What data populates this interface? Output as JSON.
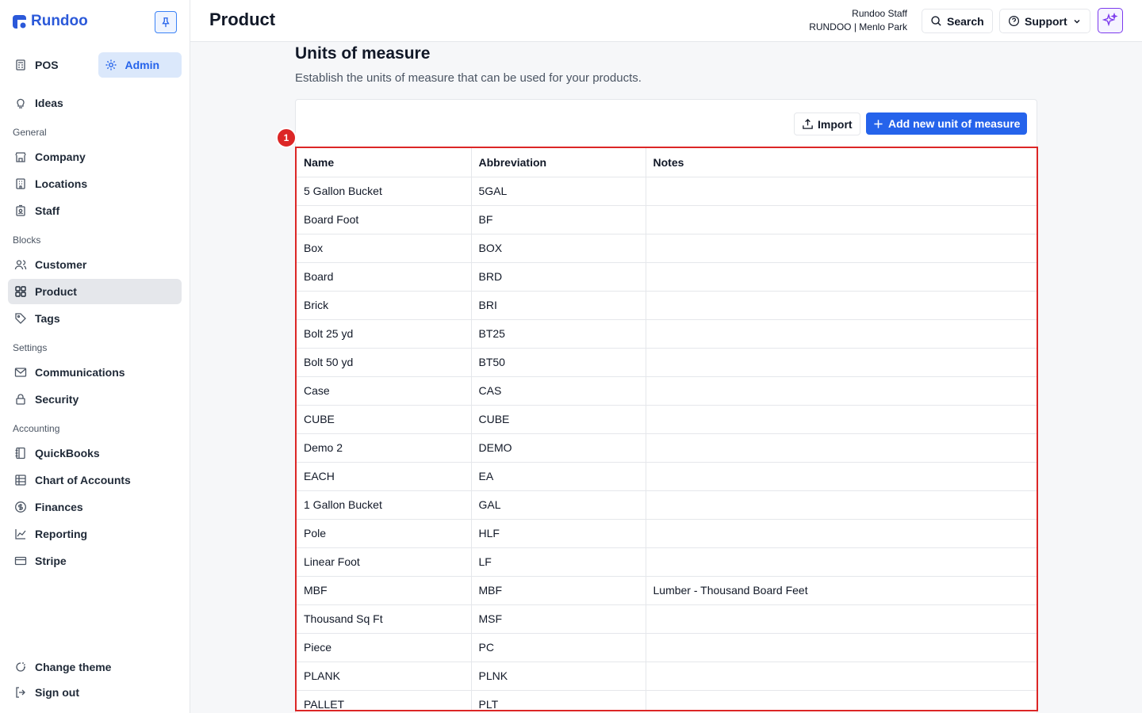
{
  "brand": {
    "name": "Rundoo"
  },
  "modes": {
    "pos": "POS",
    "admin": "Admin"
  },
  "nav": {
    "ideas": "Ideas",
    "general_label": "General",
    "company": "Company",
    "locations": "Locations",
    "staff": "Staff",
    "blocks_label": "Blocks",
    "customer": "Customer",
    "product": "Product",
    "tags": "Tags",
    "settings_label": "Settings",
    "communications": "Communications",
    "security": "Security",
    "accounting_label": "Accounting",
    "quickbooks": "QuickBooks",
    "chart_of_accounts": "Chart of Accounts",
    "finances": "Finances",
    "reporting": "Reporting",
    "stripe": "Stripe",
    "change_theme": "Change theme",
    "sign_out": "Sign out"
  },
  "header": {
    "title": "Product",
    "user_name": "Rundoo Staff",
    "user_location": "RUNDOO | Menlo Park",
    "search": "Search",
    "support": "Support"
  },
  "section": {
    "title": "Units of measure",
    "description": "Establish the units of measure that can be used for your products.",
    "import": "Import",
    "add_new": "Add new unit of measure",
    "marker": "1"
  },
  "table": {
    "columns": [
      "Name",
      "Abbreviation",
      "Notes"
    ],
    "rows": [
      [
        "5 Gallon Bucket",
        "5GAL",
        ""
      ],
      [
        "Board Foot",
        "BF",
        ""
      ],
      [
        "Box",
        "BOX",
        ""
      ],
      [
        "Board",
        "BRD",
        ""
      ],
      [
        "Brick",
        "BRI",
        ""
      ],
      [
        "Bolt 25 yd",
        "BT25",
        ""
      ],
      [
        "Bolt 50 yd",
        "BT50",
        ""
      ],
      [
        "Case",
        "CAS",
        ""
      ],
      [
        "CUBE",
        "CUBE",
        ""
      ],
      [
        "Demo 2",
        "DEMO",
        ""
      ],
      [
        "EACH",
        "EA",
        ""
      ],
      [
        "1 Gallon Bucket",
        "GAL",
        ""
      ],
      [
        "Pole",
        "HLF",
        ""
      ],
      [
        "Linear Foot",
        "LF",
        ""
      ],
      [
        "MBF",
        "MBF",
        "Lumber - Thousand Board Feet"
      ],
      [
        "Thousand Sq Ft",
        "MSF",
        ""
      ],
      [
        "Piece",
        "PC",
        ""
      ],
      [
        "PLANK",
        "PLNK",
        ""
      ],
      [
        "PALLET",
        "PLT",
        ""
      ]
    ]
  },
  "colors": {
    "accent": "#2563eb",
    "annotation": "#dc2626",
    "ai": "#7c3aed"
  }
}
